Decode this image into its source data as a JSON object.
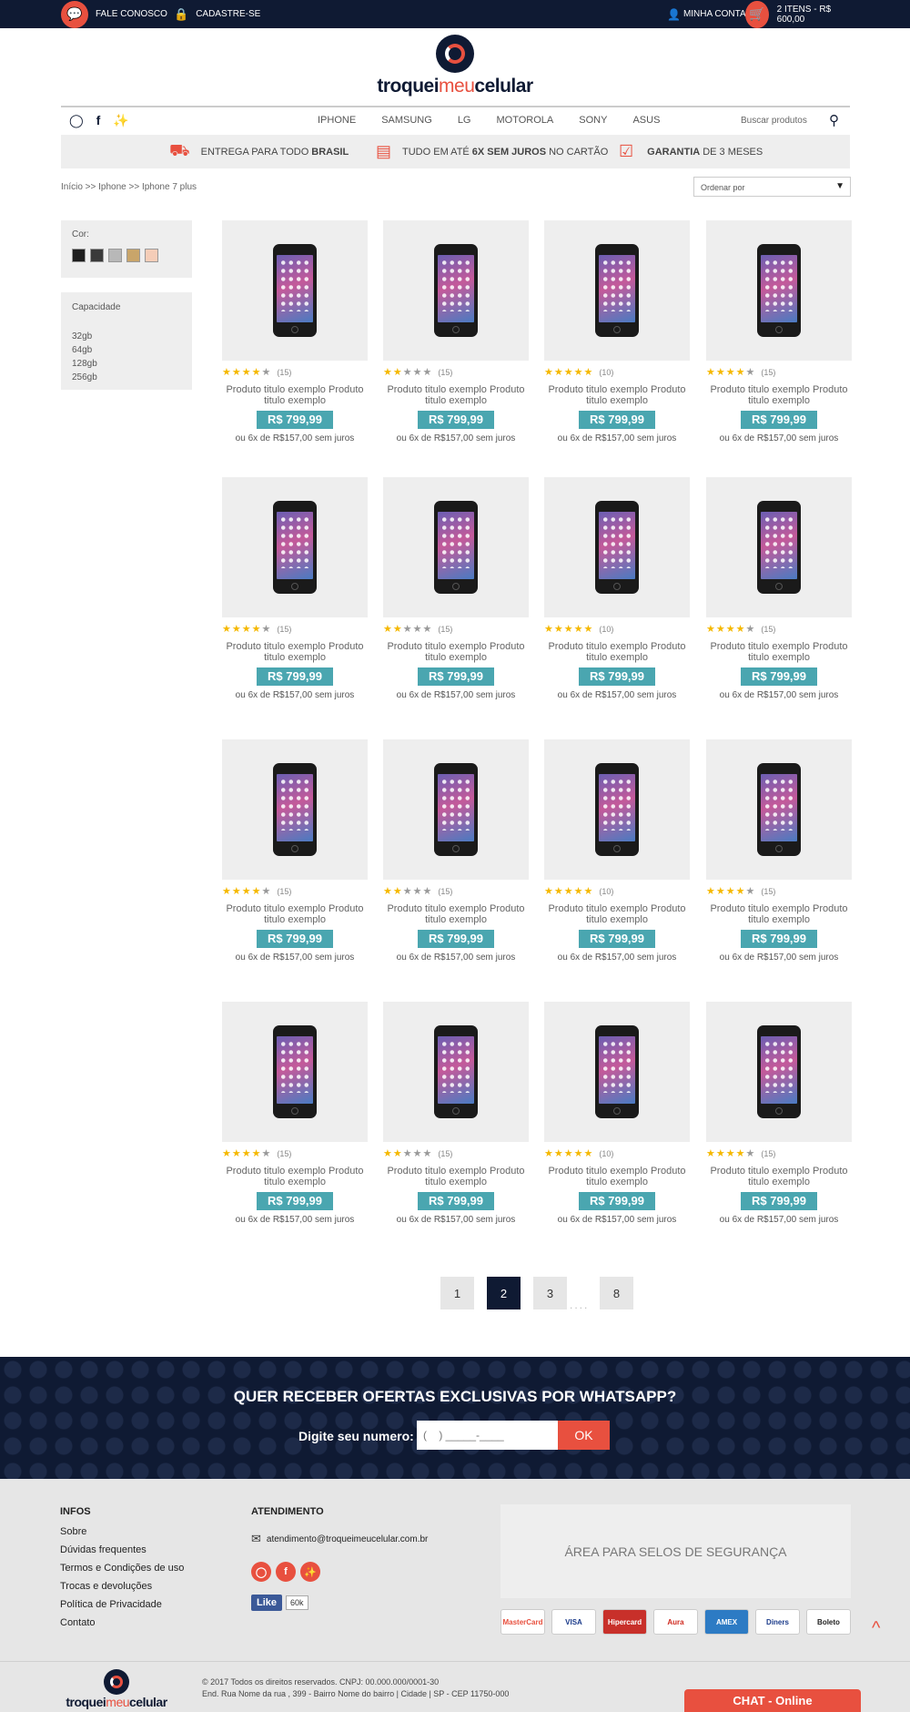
{
  "topbar": {
    "contact_label": "FALE CONOSCO",
    "register_label": "CADASTRE-SE",
    "account_label": "MINHA CONTA",
    "cart_label": "2 ITENS - R$ 600,00"
  },
  "logo": {
    "part1": "troquei",
    "part2": "meu",
    "part3": "celular"
  },
  "nav": {
    "menu": [
      "IPHONE",
      "SAMSUNG",
      "LG",
      "MOTOROLA",
      "SONY",
      "ASUS"
    ],
    "search_placeholder": "Buscar produtos"
  },
  "benefits": [
    {
      "pre": "ENTREGA PARA TODO",
      "bold": "BRASIL",
      "post": ""
    },
    {
      "pre": "TUDO EM ATÉ",
      "bold": "6X SEM JUROS",
      "post": "NO CARTÃO"
    },
    {
      "pre": "",
      "bold": "GARANTIA",
      "post": "DE 3 MESES"
    }
  ],
  "breadcrumb": "Início >> Iphone >> Iphone 7 plus",
  "sort": {
    "label": "Ordenar por"
  },
  "filters": {
    "color_label": "Cor:",
    "colors": [
      "#1e1e1e",
      "#3a3a3a",
      "#b8b8b8",
      "#c9a56a",
      "#f5cdb8"
    ],
    "capacity_label": "Capacidade",
    "capacities": [
      "32gb",
      "64gb",
      "128gb",
      "256gb"
    ]
  },
  "product_template": {
    "title": "Produto titulo exemplo Produto titulo exemplo",
    "price": "R$ 799,99",
    "installments": "ou 6x de R$157,00 sem juros"
  },
  "products": [
    {
      "stars": 4,
      "count": "(15)"
    },
    {
      "stars": 2,
      "count": "(15)"
    },
    {
      "stars": 5,
      "count": "(10)"
    },
    {
      "stars": 4,
      "count": "(15)"
    },
    {
      "stars": 4,
      "count": "(15)"
    },
    {
      "stars": 2,
      "count": "(15)"
    },
    {
      "stars": 5,
      "count": "(10)"
    },
    {
      "stars": 4,
      "count": "(15)"
    },
    {
      "stars": 4,
      "count": "(15)"
    },
    {
      "stars": 2,
      "count": "(15)"
    },
    {
      "stars": 5,
      "count": "(10)"
    },
    {
      "stars": 4,
      "count": "(15)"
    },
    {
      "stars": 4,
      "count": "(15)"
    },
    {
      "stars": 2,
      "count": "(15)"
    },
    {
      "stars": 5,
      "count": "(10)"
    },
    {
      "stars": 4,
      "count": "(15)"
    }
  ],
  "pagination": {
    "pages": [
      "1",
      "2",
      "3",
      "8"
    ],
    "active": "2",
    "ellipsis": "...."
  },
  "whatsapp": {
    "title": "QUER RECEBER OFERTAS EXCLUSIVAS POR WHATSAPP?",
    "label": "Digite seu numero:",
    "placeholder": "(    ) _____-____",
    "button": "OK"
  },
  "footer": {
    "infos_title": "INFOS",
    "infos_links": [
      "Sobre",
      "Dúvidas frequentes",
      "Termos e Condições de uso",
      "Trocas e devoluções",
      "Política de Privacidade",
      "Contato"
    ],
    "atendimento_title": "ATENDIMENTO",
    "email": "atendimento@troqueimeucelular.com.br",
    "fb_like": "Like",
    "fb_count": "60k",
    "seals_text": "ÁREA PARA SELOS DE SEGURANÇA",
    "payments": [
      "MasterCard",
      "VISA",
      "Hipercard",
      "Aura",
      "AMEX",
      "Diners",
      "Boleto"
    ],
    "copyright": "© 2017 Todos os direitos reservados. CNPJ: 00.000.000/0001-30",
    "address": "End. Rua Nome da rua , 399 - Bairro Nome do bairro | Cidade | SP - CEP 11750-000"
  },
  "chat": {
    "label": "CHAT - Online"
  }
}
